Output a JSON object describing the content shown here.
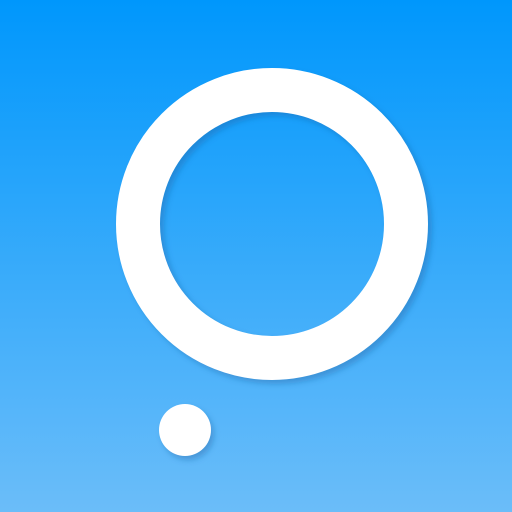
{
  "icon": {
    "name": "ring-and-dot-logo",
    "colors": {
      "background_top": "#0097FC",
      "background_bottom": "#6BBDF9",
      "ring": "#FFFFFF",
      "dot": "#FFFFFF",
      "shadow": "#1A5A9A"
    }
  }
}
